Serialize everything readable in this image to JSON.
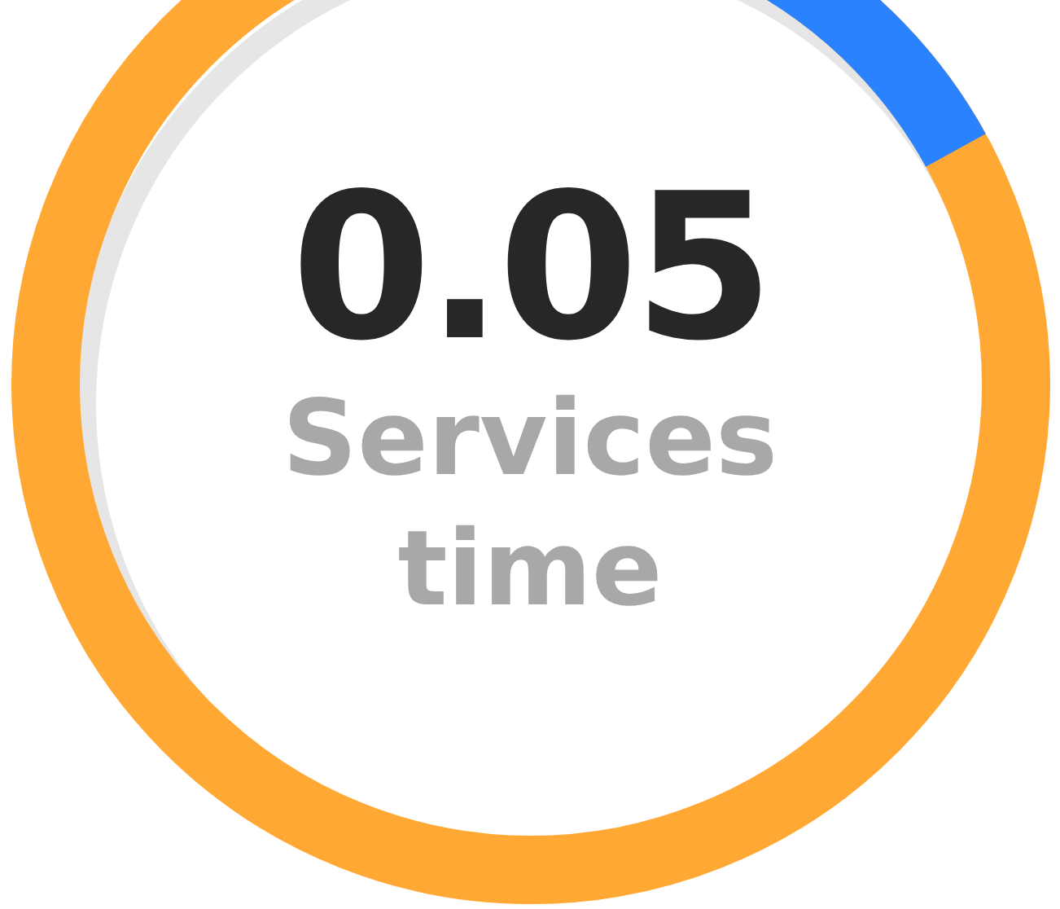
{
  "gauge": {
    "value": "0.05",
    "label": "Services time"
  }
}
